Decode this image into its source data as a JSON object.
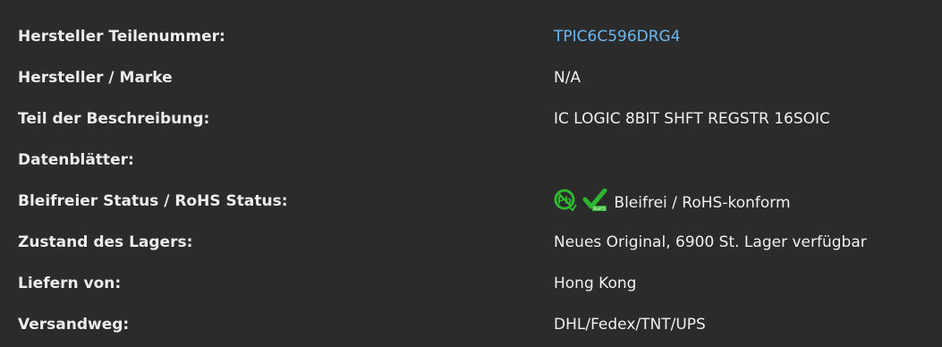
{
  "rows": [
    {
      "label": "Hersteller Teilenummer:",
      "value": "TPIC6C596DRG4"
    },
    {
      "label": "Hersteller / Marke",
      "value": "N/A"
    },
    {
      "label": "Teil der Beschreibung:",
      "value": "IC LOGIC 8BIT SHFT REGSTR 16SOIC"
    },
    {
      "label": "Datenblätter:",
      "value": ""
    },
    {
      "label": "Bleifreier Status / RoHS Status:",
      "value": "Bleifrei / RoHS-konform"
    },
    {
      "label": "Zustand des Lagers:",
      "value": "Neues Original, 6900 St. Lager verfügbar"
    },
    {
      "label": "Liefern von:",
      "value": "Hong Kong"
    },
    {
      "label": "Versandweg:",
      "value": "DHL/Fedex/TNT/UPS"
    }
  ],
  "icons": {
    "pb_free": "lead-free-icon",
    "rohs": "rohs-check-icon"
  },
  "colors": {
    "background": "#2b2b2b",
    "link": "#6cb6f0",
    "icon_green": "#2fb52f"
  }
}
